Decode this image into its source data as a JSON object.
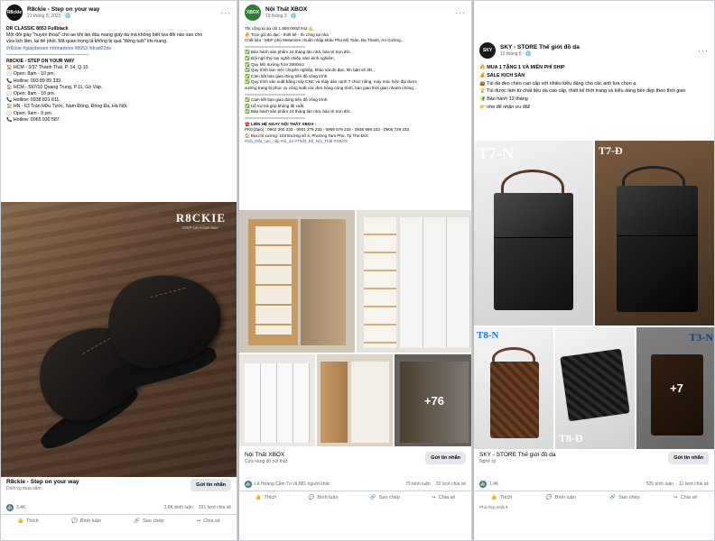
{
  "post1": {
    "name": "R8ckie - Step on your way",
    "meta": "21 tháng 8, 2023 · 🌐",
    "avatar_text": "R8ckie",
    "lines": [
      "DR CLASSIC 8053 Fullblack",
      "Một đôi giày \"huyền thoại\" cho ae khi lần đầu mang giày da mà không biết lựa đôi nào sao cho",
      "vừa lịch lãm, lại dễ phối. Mã quan trọng là không bị quá \"đứng tuổi\" khi mang.",
      "#r8ckie #giaydanam #drmartens #8053 #drad02de",
      "-----------------------------------------------------",
      "R8CKIE - STEP ON YOUR WAY",
      "🏠 HCM - 3/37 Thành Thái, P. 14, Q.10.",
      "🕗 Open: 8am - 10 pm.",
      "📞 Hotline: 093 89 89 339.",
      "🏠 HCM - 597/10 Quang Trung, P.11, Gò Vấp.",
      "🕗 Open: 8am - 10 pm.",
      "📞 Hotline: 0938 821 811.",
      "🏠 HN - 63 Trần Hữu Tước, Nam Đồng, Đống Đa, Hà Nội.",
      "🕗 Open: 9am - 9 pm.",
      "📞 Hotline: 0965 930 587"
    ],
    "brand": "R8CKIE",
    "brand_sub": "STEP ON YOUR WAY",
    "footer_title": "R8ckie - Step on your way",
    "footer_sub": "Dịch vụ mua sắm",
    "message_btn": "Gửi tin nhắn",
    "likes": "3,4K",
    "comments": "2,8K bình luận",
    "shares": "191 lượt chia sẻ",
    "like_label": "Thích",
    "comment_label": "Bình luận",
    "copy_label": "Sao chép",
    "share_label": "Chia sẻ"
  },
  "post2": {
    "name": "Nội Thất XBOX",
    "meta": "19 tháng 3 · 🌐",
    "avatar_text": "XBOX",
    "lines": [
      "Thi công tủ áo chỉ 1.800.000đ /m2 💪",
      "🔥 Trọn gói đo đạc - thiết kế - thi công tại nhà",
      "Chất liệu : MDF phủ Melamine chuẩn nhập khẩu Phú Mỹ Toàn, Ba Thanh, An Cường...",
      "=========================",
      "✅ Bảo hành sản phẩm 24 tháng tận nhà, bảo trì trọn đời.",
      "✅ Đội ngũ thợ tay nghề nhiều năm kinh nghiệm,",
      "✅ Quy Mô Xưởng hơn 2000m2",
      "✅ Quy trình làm việc chuyên nghiệp, khảo sát đo đạc, lên bản vẽ 3D...",
      "✅ Cam kết bàn giao đúng tiến độ công trình.",
      "✅ Quy trình sản xuất bằng máy CNC và máy dán cạnh 7 chức năng, máy móc hiện đại được",
      "xưởng trang bị phục vụ công suất các đơn hàng công trình, bàn giao thời gian nhanh chóng...",
      "=========================",
      "✅ Cam kết bàn giao đúng tiến độ công trình.",
      "✅ Hỗ trợ trả góp không lãi xuất.",
      "✅ Bảo hành sản phẩm 24 tháng tận nhà, bảo trì trọn đời.",
      "=========================",
      "☎️ LIÊN HỆ NGAY NỘI THẤT XBOX :",
      "PKD(Zalo) : 0902 360 233 - 0901 379 233 - 0909 679 233 - 0938 959 233 - 0906 729 233",
      "🏠 Địa chỉ xưởng: 103 Đường số 4, Phường Tam Phú, Tp Thủ Đức",
      "#nội_thất_cao_cấp #tủ_áo #Thiết_Kế_Nội_Thất #XBOX"
    ],
    "more_count": "+76",
    "footer_title": "Nội Thất XBOX",
    "footer_sub": "Cửa hàng đồ nội thất",
    "message_btn": "Gửi tin nhắn",
    "reactors": "Lê Hoàng Cẩm Tú và 881 người khác",
    "comments": "79 bình luận",
    "shares": "32 lượt chia sẻ",
    "like_label": "Thích",
    "comment_label": "Bình luận",
    "copy_label": "Sao chép",
    "share_label": "Chia sẻ"
  },
  "post3": {
    "name": "SKY - STORE Thế giới đồ da",
    "meta": "12 tháng 5 · 🌐",
    "avatar_text": "SKY",
    "lines": [
      "🔥 MUA 1 TẶNG 1 VÀ MIỄN PHÍ SHIP",
      "💰 SALE KỊCH SÀN",
      "👜 Túi da đeo chéo cao cấp với nhiều kiểu dáng cho các anh lựa chọn ạ.",
      "💡 Túi được làm từ chất liệu da cao cấp, thiết kế thời trang và kiểu dáng bền đẹp theo thời gian",
      "🔰 Bảo hành 12 tháng",
      "👉 nhẹ để nhận ưu đãi!"
    ],
    "tags": [
      "T7-N",
      "T7-Đ",
      "T8-N",
      "T8-Đ",
      "T3-N"
    ],
    "more_count": "+7",
    "footer_title": "SKY - STORE Thế giới đồ da",
    "footer_sub": "Nghệ sỹ",
    "message_btn": "Gửi tin nhắn",
    "likes": "1,4K",
    "comments": "525 bình luận",
    "shares": "11 lượt chia sẻ",
    "like_label": "Thích",
    "comment_label": "Bình luận",
    "copy_label": "Sao chép",
    "share_label": "Chia sẻ",
    "relevant": "Phù hợp nhất ▾"
  },
  "colors": {
    "accent": "#1877f2",
    "link": "#385898"
  }
}
